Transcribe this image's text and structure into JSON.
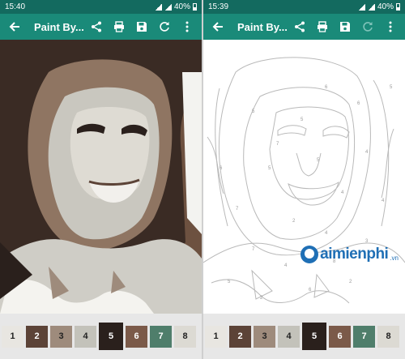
{
  "left": {
    "status": {
      "time": "15:40",
      "battery": "40%"
    },
    "appbar": {
      "title": "Paint By..."
    }
  },
  "right": {
    "status": {
      "time": "15:39",
      "battery": "40%"
    },
    "appbar": {
      "title": "Paint By..."
    }
  },
  "palette": [
    {
      "label": "1",
      "color": "#e8e6e1",
      "text_color": "#222"
    },
    {
      "label": "2",
      "color": "#5c4337",
      "text_color": "#fff"
    },
    {
      "label": "3",
      "color": "#9e8b7c",
      "text_color": "#222"
    },
    {
      "label": "4",
      "color": "#c3c2ba",
      "text_color": "#222"
    },
    {
      "label": "5",
      "color": "#2a201c",
      "text_color": "#fff"
    },
    {
      "label": "6",
      "color": "#7b5a49",
      "text_color": "#fff"
    },
    {
      "label": "7",
      "color": "#4f7e6b",
      "text_color": "#fff"
    },
    {
      "label": "8",
      "color": "#dcdad3",
      "text_color": "#222"
    }
  ],
  "palette_selected": 5,
  "watermark": {
    "brand": "aimienphi",
    "tld": ".vn"
  },
  "outline_numbers": [
    "5",
    "6",
    "5",
    "4",
    "5",
    "4",
    "7",
    "2",
    "5",
    "6",
    "7",
    "4",
    "8",
    "3",
    "5",
    "6",
    "2",
    "4",
    "7",
    "5",
    "6",
    "4",
    "2"
  ]
}
